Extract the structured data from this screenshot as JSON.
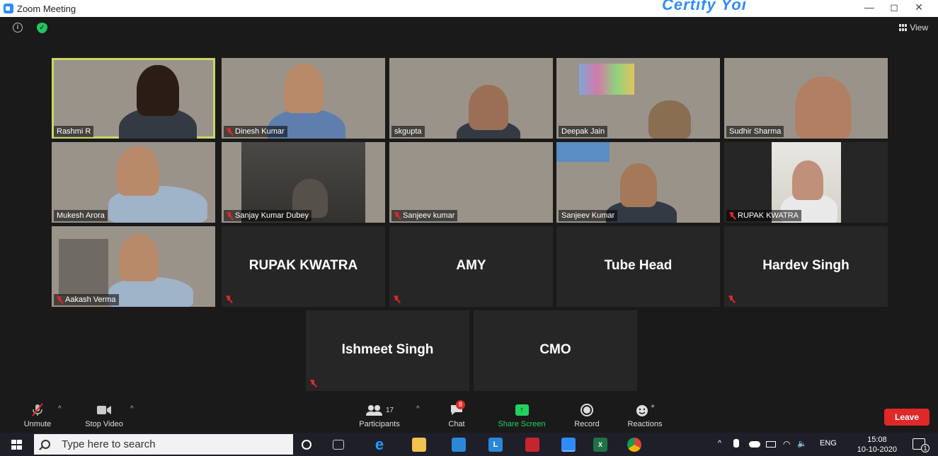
{
  "window": {
    "title": "Zoom Meeting",
    "overlay_text": "Certify Yoi",
    "minimize": "—",
    "restore": "◻",
    "close": "✕"
  },
  "header": {
    "view_label": "View"
  },
  "participants_grid": [
    {
      "name": "Rashmi R",
      "muted": false,
      "video": true,
      "active": true
    },
    {
      "name": "Dinesh Kumar",
      "muted": true,
      "video": true
    },
    {
      "name": "skgupta",
      "muted": false,
      "video": true
    },
    {
      "name": "Deepak Jain",
      "muted": false,
      "video": true
    },
    {
      "name": "Sudhir Sharma",
      "muted": false,
      "video": true
    },
    {
      "name": "Mukesh Arora",
      "muted": false,
      "video": true
    },
    {
      "name": "Sanjay Kumar Dubey",
      "muted": true,
      "video": true
    },
    {
      "name": "Sanjeev kumar",
      "muted": true,
      "video": true
    },
    {
      "name": "Sanjeev Kumar",
      "muted": false,
      "video": true
    },
    {
      "name": "RUPAK KWATRA",
      "muted": true,
      "video": true
    },
    {
      "name": "Aakash Verma",
      "muted": true,
      "video": true
    },
    {
      "name": "RUPAK KWATRA",
      "muted": true,
      "video": false
    },
    {
      "name": "AMY",
      "muted": true,
      "video": false
    },
    {
      "name": "Tube Head",
      "muted": false,
      "video": false
    },
    {
      "name": "Hardev Singh",
      "muted": true,
      "video": false
    },
    {
      "name": "Ishmeet Singh",
      "muted": true,
      "video": false
    },
    {
      "name": "CMO",
      "muted": false,
      "video": false
    }
  ],
  "toolbar": {
    "unmute": "Unmute",
    "stop_video": "Stop Video",
    "participants": "Participants",
    "participants_count": "17",
    "chat": "Chat",
    "chat_badge": "8",
    "share_screen": "Share Screen",
    "record": "Record",
    "reactions": "Reactions",
    "leave": "Leave",
    "share_arrow": "↑",
    "caret": "^",
    "reactions_plus": "+"
  },
  "taskbar": {
    "search_placeholder": "Type here to search",
    "language": "ENG",
    "time": "15:08",
    "date": "10-10-2020",
    "notifications_count": "1",
    "tray_caret": "^",
    "volume_icon": "🔈"
  },
  "colors": {
    "accent": "#2d8cff",
    "active_speaker": "#c8d66b",
    "share_green": "#23d160",
    "leave_red": "#e02828",
    "mute_red": "#e02828"
  }
}
